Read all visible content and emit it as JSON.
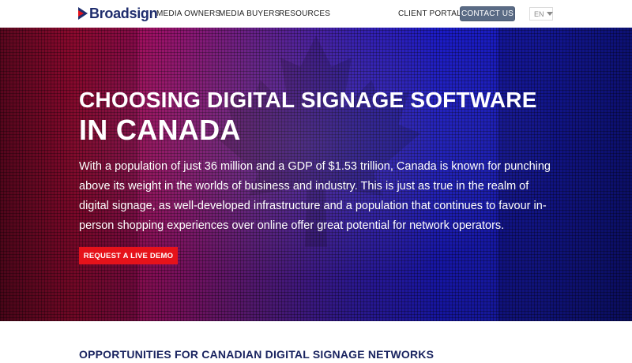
{
  "header": {
    "logo_text": "Broadsign",
    "nav": {
      "media_owners": "MEDIA OWNERS",
      "media_buyers": "MEDIA BUYERS",
      "resources": "RESOURCES",
      "client_portal": "CLIENT PORTAL"
    },
    "contact_label": "CONTACT US",
    "language": "EN"
  },
  "hero": {
    "title_line1": "CHOOSING DIGITAL SIGNAGE SOFTWARE",
    "title_line2": "IN CANADA",
    "paragraph": "With a population of just 36 million and a GDP of $1.53 trillion, Canada is known for punching above its weight in the worlds of business and industry. This is just as true in the realm of digital signage, as well-developed infrastructure and a population that continues to favour in-person shopping experiences over online offer great potential for network operators.",
    "cta_label": "REQUEST A LIVE DEMO"
  },
  "section": {
    "heading": "OPPORTUNITIES FOR CANADIAN DIGITAL SIGNAGE NETWORKS"
  },
  "colors": {
    "brand_navy": "#1f2d6e",
    "logo_red": "#e6121a",
    "contact_button": "#5a6b85",
    "cta_red": "#e6121a",
    "heading_navy": "#1a2460"
  },
  "icons": {
    "logo": "broadsign-play-mark",
    "language_caret": "caret-down-icon",
    "hero_background": "maple-leaf-icon"
  }
}
